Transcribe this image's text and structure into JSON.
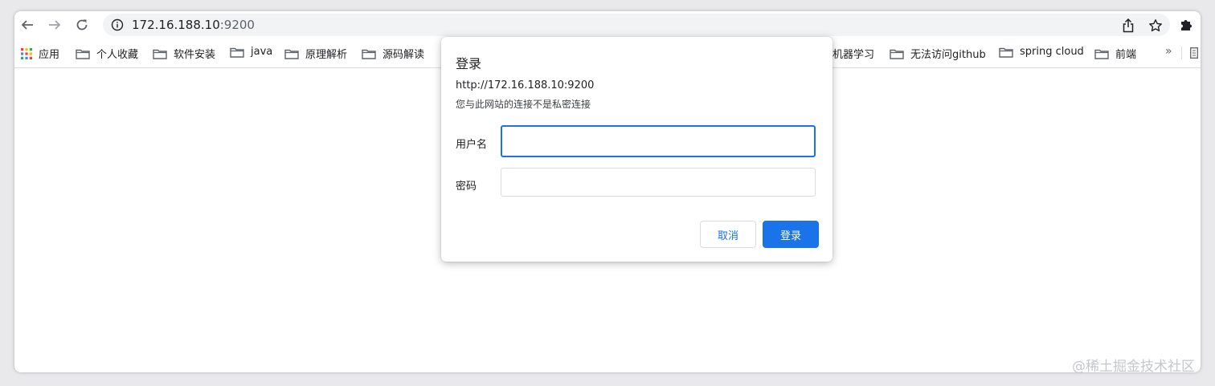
{
  "browser": {
    "url_host": "172.16.188.10",
    "url_port": ":9200",
    "icons": {
      "back": "back-arrow-icon",
      "forward": "forward-arrow-icon",
      "reload": "reload-icon",
      "info": "info-icon",
      "share": "share-icon",
      "bookmark": "star-icon",
      "extensions": "puzzle-icon"
    }
  },
  "bookmarks": {
    "items": [
      {
        "label": "应用",
        "icon": "apps-grid-icon"
      },
      {
        "label": "个人收藏",
        "icon": "folder-icon"
      },
      {
        "label": "软件安装",
        "icon": "folder-icon"
      },
      {
        "label": "java",
        "icon": "folder-icon"
      },
      {
        "label": "原理解析",
        "icon": "folder-icon"
      },
      {
        "label": "源码解读",
        "icon": "folder-icon"
      },
      {
        "label": "机器学习",
        "icon": ""
      },
      {
        "label": "无法访问github",
        "icon": "folder-icon"
      },
      {
        "label": "spring cloud",
        "icon": "folder-icon"
      },
      {
        "label": "前端",
        "icon": "folder-icon"
      }
    ],
    "more": "»"
  },
  "dialog": {
    "title": "登录",
    "url": "http://172.16.188.10:9200",
    "warning": "您与此网站的连接不是私密连接",
    "username_label": "用户名",
    "username_value": "",
    "password_label": "密码",
    "password_value": "",
    "cancel_label": "取消",
    "login_label": "登录"
  },
  "watermark": "@稀土掘金技术社区",
  "colors": {
    "accent": "#1a73e8",
    "omnibox_bg": "#f1f3f4"
  }
}
